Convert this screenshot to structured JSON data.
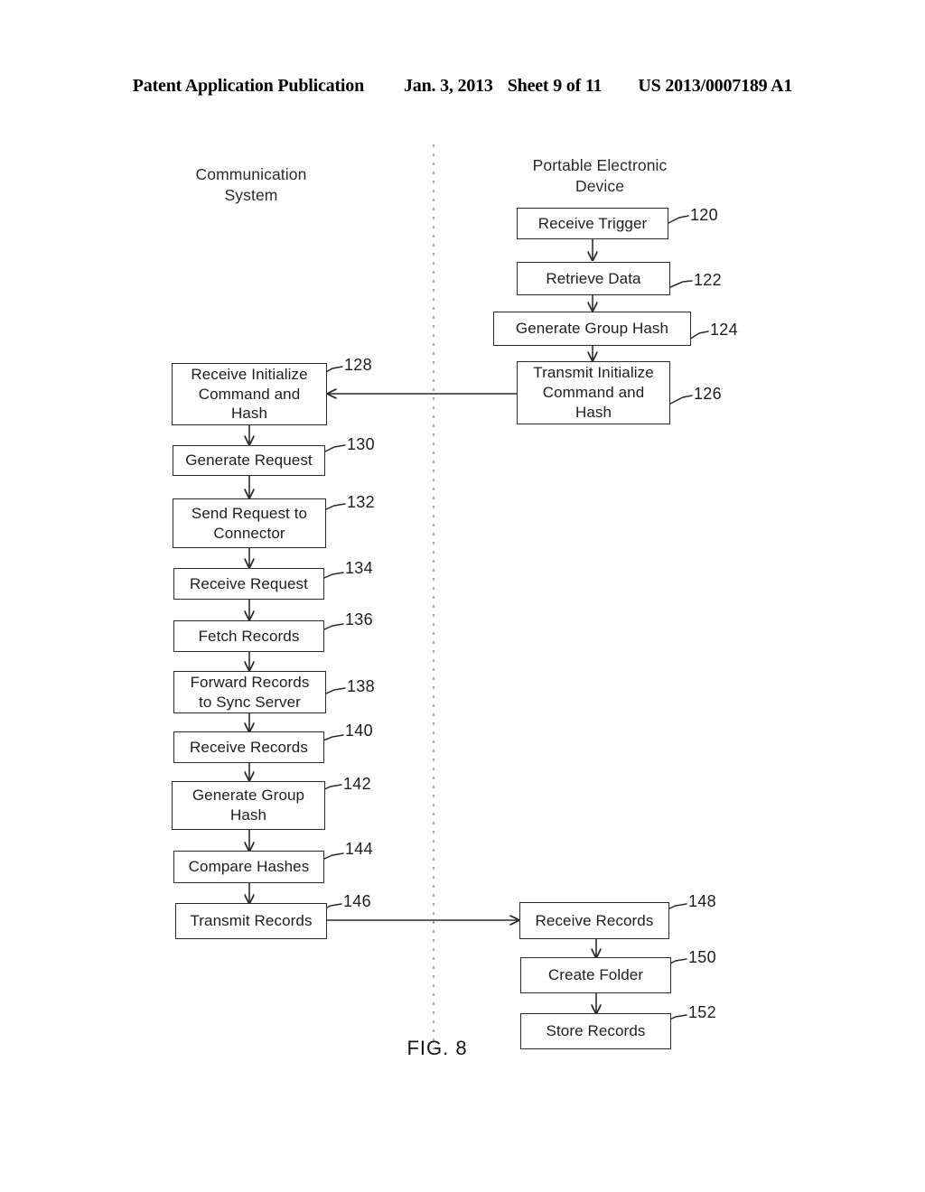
{
  "header": {
    "publication": "Patent Application Publication",
    "date": "Jan. 3, 2013",
    "sheet": "Sheet 9 of 11",
    "patent_number": "US 2013/0007189 A1"
  },
  "figure": {
    "caption": "FIG. 8",
    "divider": "vertical-dashed-swimlane-divider"
  },
  "columns": [
    {
      "id": "communication-system",
      "label": "Communication\nSystem"
    },
    {
      "id": "portable-electronic-device",
      "label": "Portable Electronic\nDevice"
    }
  ],
  "boxes": [
    {
      "id": "receive-trigger",
      "label": "Receive Trigger",
      "ref": "120",
      "column": "portable-electronic-device"
    },
    {
      "id": "retrieve-data",
      "label": "Retrieve Data",
      "ref": "122",
      "column": "portable-electronic-device"
    },
    {
      "id": "generate-group-hash-device",
      "label": "Generate Group Hash",
      "ref": "124",
      "column": "portable-electronic-device"
    },
    {
      "id": "transmit-initialize",
      "label": "Transmit Initialize\nCommand and\nHash",
      "ref": "126",
      "column": "portable-electronic-device"
    },
    {
      "id": "receive-initialize",
      "label": "Receive Initialize\nCommand and\nHash",
      "ref": "128",
      "column": "communication-system"
    },
    {
      "id": "generate-request",
      "label": "Generate Request",
      "ref": "130",
      "column": "communication-system"
    },
    {
      "id": "send-request-to-connector",
      "label": "Send Request to\nConnector",
      "ref": "132",
      "column": "communication-system"
    },
    {
      "id": "receive-request",
      "label": "Receive Request",
      "ref": "134",
      "column": "communication-system"
    },
    {
      "id": "fetch-records",
      "label": "Fetch Records",
      "ref": "136",
      "column": "communication-system"
    },
    {
      "id": "forward-records-to-sync",
      "label": "Forward Records\nto Sync Server",
      "ref": "138",
      "column": "communication-system"
    },
    {
      "id": "receive-records-system",
      "label": "Receive Records",
      "ref": "140",
      "column": "communication-system"
    },
    {
      "id": "generate-group-hash-system",
      "label": "Generate Group\nHash",
      "ref": "142",
      "column": "communication-system"
    },
    {
      "id": "compare-hashes",
      "label": "Compare Hashes",
      "ref": "144",
      "column": "communication-system"
    },
    {
      "id": "transmit-records",
      "label": "Transmit Records",
      "ref": "146",
      "column": "communication-system"
    },
    {
      "id": "receive-records-device",
      "label": "Receive Records",
      "ref": "148",
      "column": "portable-electronic-device"
    },
    {
      "id": "create-folder",
      "label": "Create Folder",
      "ref": "150",
      "column": "portable-electronic-device"
    },
    {
      "id": "store-records",
      "label": "Store Records",
      "ref": "152",
      "column": "portable-electronic-device"
    }
  ],
  "connectors": [
    {
      "from": "receive-trigger",
      "to": "retrieve-data",
      "kind": "vertical-arrow"
    },
    {
      "from": "retrieve-data",
      "to": "generate-group-hash-device",
      "kind": "vertical-arrow"
    },
    {
      "from": "generate-group-hash-device",
      "to": "transmit-initialize",
      "kind": "vertical-arrow"
    },
    {
      "from": "transmit-initialize",
      "to": "receive-initialize",
      "kind": "horizontal-arrow-left"
    },
    {
      "from": "receive-initialize",
      "to": "generate-request",
      "kind": "vertical-arrow"
    },
    {
      "from": "generate-request",
      "to": "send-request-to-connector",
      "kind": "vertical-arrow"
    },
    {
      "from": "send-request-to-connector",
      "to": "receive-request",
      "kind": "vertical-arrow"
    },
    {
      "from": "receive-request",
      "to": "fetch-records",
      "kind": "vertical-arrow"
    },
    {
      "from": "fetch-records",
      "to": "forward-records-to-sync",
      "kind": "vertical-arrow"
    },
    {
      "from": "forward-records-to-sync",
      "to": "receive-records-system",
      "kind": "vertical-arrow"
    },
    {
      "from": "receive-records-system",
      "to": "generate-group-hash-system",
      "kind": "vertical-arrow"
    },
    {
      "from": "generate-group-hash-system",
      "to": "compare-hashes",
      "kind": "vertical-arrow"
    },
    {
      "from": "compare-hashes",
      "to": "transmit-records",
      "kind": "vertical-arrow"
    },
    {
      "from": "transmit-records",
      "to": "receive-records-device",
      "kind": "horizontal-arrow-right"
    },
    {
      "from": "receive-records-device",
      "to": "create-folder",
      "kind": "vertical-arrow"
    },
    {
      "from": "create-folder",
      "to": "store-records",
      "kind": "vertical-arrow"
    }
  ]
}
